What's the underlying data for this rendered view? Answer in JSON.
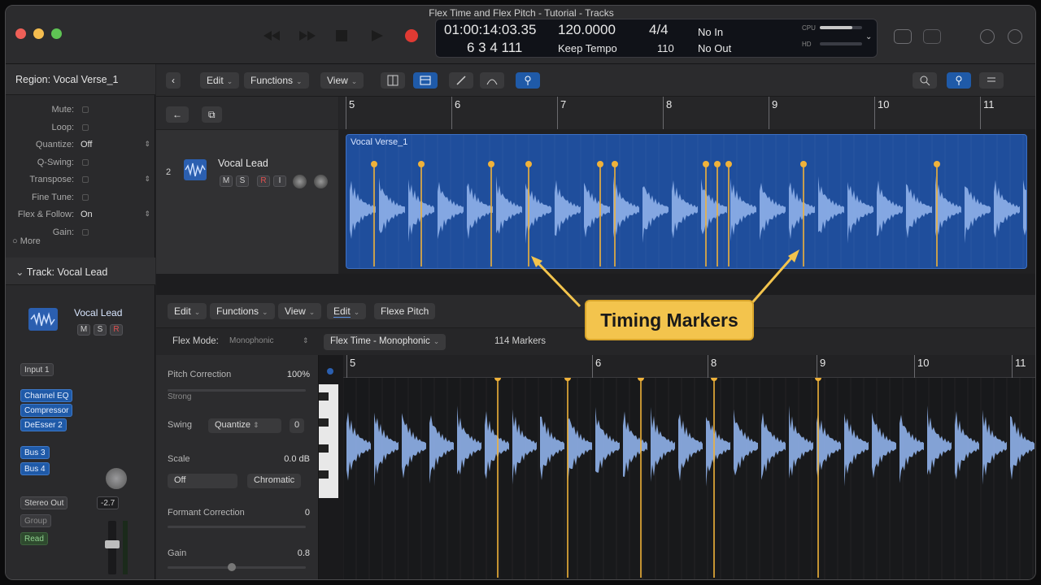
{
  "window": {
    "title": "Flex Time and Flex Pitch - Tutorial - Tracks"
  },
  "lcd": {
    "position_time": "01:00:14:03.35",
    "position_bars": "6  3  4  111",
    "tempo": "120.0000",
    "tempo_mode": "Keep Tempo",
    "signature": "4/4",
    "division": "110",
    "midi_in": "No In",
    "midi_out": "No Out",
    "cpu_label": "CPU",
    "hd_label": "HD"
  },
  "inspector": {
    "region_title": "Region: Vocal Verse_1",
    "params": [
      {
        "label": "Mute:",
        "value": ""
      },
      {
        "label": "Loop:",
        "value": ""
      },
      {
        "label": "Quantize:",
        "value": "Off"
      },
      {
        "label": "Q-Swing:",
        "value": ""
      },
      {
        "label": "Transpose:",
        "value": ""
      },
      {
        "label": "Fine Tune:",
        "value": ""
      },
      {
        "label": "Flex & Follow:",
        "value": "On"
      },
      {
        "label": "Gain:",
        "value": ""
      }
    ],
    "more_label": "More",
    "track_title": "Track: Vocal Lead",
    "track_name": "Vocal Lead",
    "input": "Input 1",
    "plugins": [
      "Channel EQ",
      "Compressor",
      "DeEsser 2"
    ],
    "sends": [
      "Bus 3",
      "Bus 4"
    ],
    "output": "Stereo Out",
    "group": "Group",
    "read": "Read",
    "db_value": "-2.7",
    "m_label": "M",
    "s_label": "S",
    "r_label": "R"
  },
  "toolbar": {
    "edit": "Edit",
    "functions": "Functions",
    "view": "View"
  },
  "track": {
    "number": "2",
    "name": "Vocal Lead",
    "m": "M",
    "s": "S",
    "r": "R",
    "i": "I"
  },
  "ruler": {
    "bars": [
      "5",
      "6",
      "7",
      "8",
      "9",
      "10",
      "11"
    ]
  },
  "region": {
    "name": "Vocal Verse_1"
  },
  "editor": {
    "edit": "Edit",
    "functions": "Functions",
    "view": "View",
    "edit2": "Edit",
    "flex_pitch": "Flexe Pitch",
    "flex_mode_label": "Flex Mode:",
    "flex_mode_value": "Monophonic",
    "flex_algorithm": "Flex Time - Monophonic",
    "markers": "114 Markers",
    "pitch_correction_label": "Pitch Correction",
    "pitch_correction_value": "100%",
    "strong": "Strong",
    "swing": "Swing",
    "quantize": "Quantize",
    "q_value": "0",
    "scale_label": "Scale",
    "scale_value": "0.0 dB",
    "off_btn": "Off",
    "chromatic": "Chromatic",
    "formant_label": "Formant Correction",
    "formant_value": "0",
    "gain_label": "Gain",
    "gain_value": "0.8",
    "ruler_bars": [
      "5",
      "6",
      "8",
      "9",
      "10",
      "11"
    ]
  },
  "callout": {
    "text": "Timing Markers"
  },
  "colors": {
    "region_blue": "#1f4e9c",
    "waveform": "#8fb1ea",
    "marker": "#f0b23a",
    "callout": "#f3c44d",
    "accent": "#1f5aa8"
  }
}
